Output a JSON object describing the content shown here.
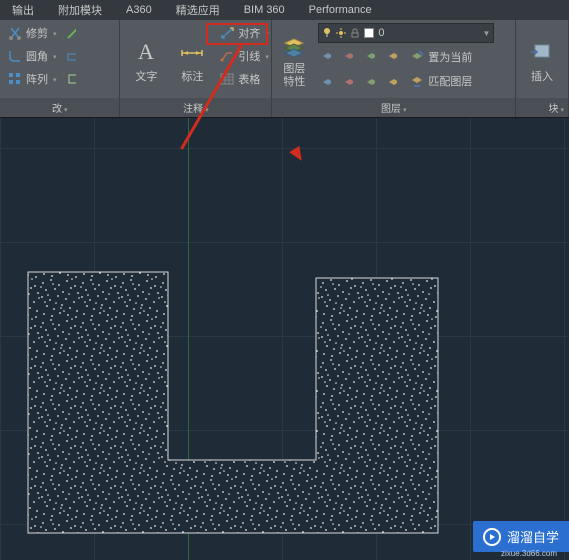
{
  "menubar": {
    "items": [
      "输出",
      "附加模块",
      "A360",
      "精选应用",
      "BIM 360",
      "Performance"
    ]
  },
  "ribbon": {
    "modify": {
      "trim": "修剪",
      "fillet": "圆角",
      "array": "阵列",
      "label": "改"
    },
    "annotate": {
      "text": "文字",
      "dim": "标注",
      "align": "对齐",
      "leader": "引线",
      "table": "表格",
      "label": "注释"
    },
    "layers": {
      "props": "图层\n特性",
      "selected": "0",
      "match": "匹配图层",
      "current": "置为当前",
      "label": "图层"
    },
    "insert": {
      "label": "插入"
    }
  },
  "watermark": {
    "text": "溜溜自学",
    "sub": "zixue.3d66.com"
  }
}
